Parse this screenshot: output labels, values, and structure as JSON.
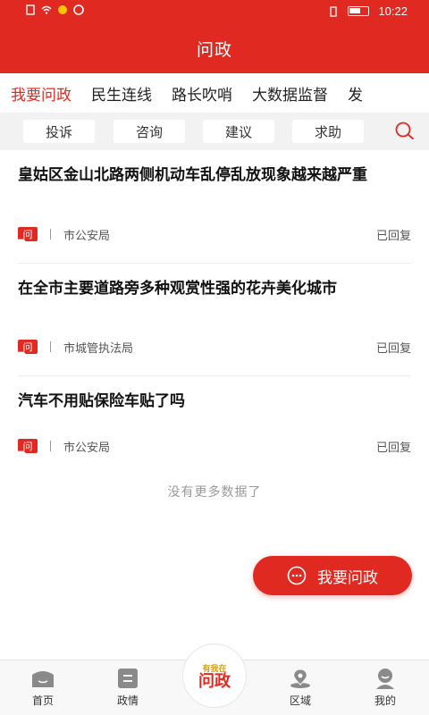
{
  "status_bar": {
    "time": "10:22"
  },
  "header": {
    "title": "问政"
  },
  "category_tabs": [
    "我要问政",
    "民生连线",
    "路长吹哨",
    "大数据监督",
    "发"
  ],
  "filters": [
    "投诉",
    "咨询",
    "建议",
    "求助"
  ],
  "items": [
    {
      "title": "皇姑区金山北路两侧机动车乱停乱放现象越来越严重",
      "badge": "问",
      "department": "市公安局",
      "status": "已回复"
    },
    {
      "title": "在全市主要道路旁多种观赏性强的花卉美化城市",
      "badge": "问",
      "department": "市城管执法局",
      "status": "已回复"
    },
    {
      "title": "汽车不用贴保险车贴了吗",
      "badge": "问",
      "department": "市公安局",
      "status": "已回复"
    }
  ],
  "no_more_text": "没有更多数据了",
  "fab": {
    "label": "我要问政"
  },
  "tabbar": {
    "items": [
      {
        "label": "首页",
        "icon": "home-icon"
      },
      {
        "label": "政情",
        "icon": "news-icon"
      },
      {
        "label": "区域",
        "icon": "location-icon"
      },
      {
        "label": "我的",
        "icon": "user-icon"
      }
    ],
    "center_logo": {
      "top": "有我在",
      "main": "问政"
    }
  },
  "colors": {
    "brand": "#e02a21",
    "filter_bg": "#f2f2f2"
  }
}
